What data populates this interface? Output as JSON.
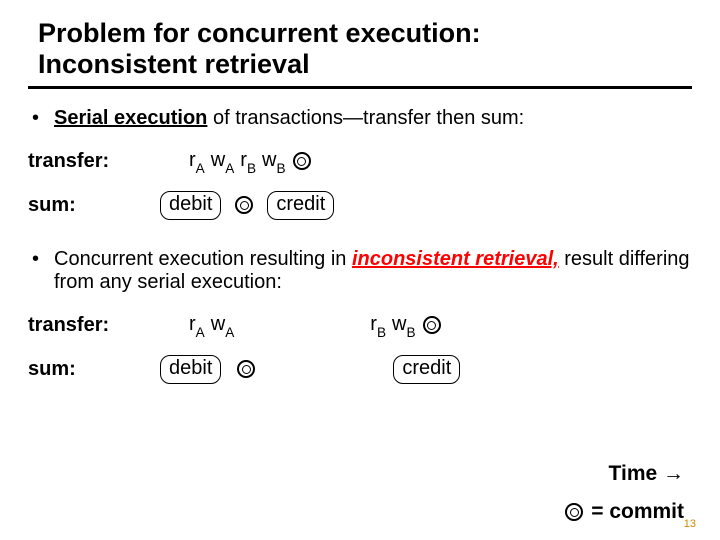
{
  "title_l1": "Problem for concurrent execution:",
  "title_l2": "Inconsistent retrieval",
  "bullet1_a": "Serial execution",
  "bullet1_b": " of transactions—transfer then sum:",
  "labels": {
    "transfer": "transfer:",
    "sum": "sum:"
  },
  "ops": {
    "rA_r": "r",
    "rA_s": "A",
    "wA_r": "w",
    "wA_s": "A",
    "rB_r": "r",
    "rB_s": "B",
    "wB_r": "w",
    "wB_s": "B",
    "debit": "debit",
    "credit": "credit"
  },
  "bullet2_a": "Concurrent execution resulting in ",
  "bullet2_red": "inconsistent retrieval,",
  "bullet2_b": " result differing from any serial execution:",
  "footer": {
    "time": "Time ",
    "eq": " = commit"
  },
  "page": "13"
}
